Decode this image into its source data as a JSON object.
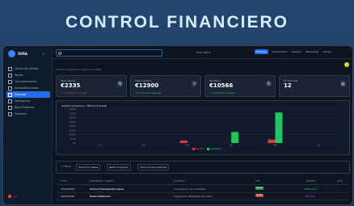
{
  "headline": "CONTROL FINANCIERO",
  "brand": {
    "name": "XERA",
    "close": "×"
  },
  "sidebar": {
    "items": [
      {
        "label": "Centro de Control",
        "active": false
      },
      {
        "label": "Tareas",
        "active": false
      },
      {
        "label": "Comunicaciones",
        "active": false
      },
      {
        "label": "Automatizaciones",
        "active": false
      },
      {
        "label": "Finanzas",
        "active": true
      },
      {
        "label": "Inteligencia",
        "active": false
      },
      {
        "label": "Base Sistemas",
        "active": false
      },
      {
        "label": "Miniones",
        "active": false
      }
    ],
    "footer": "Live"
  },
  "topbar": {
    "search_placeholder": "",
    "user": "Modo Maria",
    "nav": [
      {
        "label": "Finanzas",
        "active": true
      },
      {
        "label": "Contabilidad",
        "active": false
      },
      {
        "label": "Reporte",
        "active": false
      },
      {
        "label": "Marketing",
        "active": false
      },
      {
        "label": "Ventas",
        "active": false
      }
    ]
  },
  "subtitle": "Control de gastos e ingresos de XERA",
  "cards": [
    {
      "label": "Total Gastos",
      "value": "€2335",
      "sub": "↑ Incremento mensual",
      "sub_color": "#e05555",
      "icon": "%"
    },
    {
      "label": "Total Ingresos",
      "value": "€12900",
      "sub": "↑ Incremento mensual",
      "sub_color": "#28c76f",
      "icon": "↑"
    },
    {
      "label": "Beneficio",
      "value": "€10566",
      "sub": "↑ Incremento mensual",
      "sub_color": "#28c76f",
      "icon": "€"
    },
    {
      "label": "Nº Facturas",
      "value": "12",
      "sub": "",
      "sub_color": "#28c76f",
      "icon": "▤"
    }
  ],
  "chart_data": {
    "type": "bar",
    "title": "Gastos vs Ingresos - Últimos 6 meses",
    "categories": [
      "Ene",
      "Feb",
      "Mar",
      "Abr",
      "May",
      "Jun"
    ],
    "series": [
      {
        "name": "Gastos",
        "color": "#e03b3b",
        "values": [
          0,
          0,
          300,
          0,
          400,
          0
        ]
      },
      {
        "name": "Ingresos",
        "color": "#22c55e",
        "values": [
          0,
          0,
          0,
          1300,
          3600,
          0
        ]
      }
    ],
    "y_ticks": [
      "€4000",
      "€3500",
      "€3000",
      "€2500",
      "€2000",
      "€1500",
      "€1000",
      "€500",
      "€0"
    ],
    "ylim": [
      0,
      4000
    ],
    "legend_position": "bottom"
  },
  "filters": {
    "label": "Filtros",
    "selects": [
      "Todos los meses",
      "Gasto e Ingreso",
      "Todos los proveedores"
    ]
  },
  "table": {
    "headers": [
      "FECHA",
      "PROVEEDOR / CLIENTE",
      "CONCEPTO",
      "TIPO",
      "IMPORTE",
      "ACCS"
    ],
    "rows": [
      {
        "date": "30/05/2025",
        "party": "Clínica Fisioquinta López",
        "concept": "Consultoría e IA completa",
        "type": "Ingreso",
        "type_color": "#1f9d55",
        "amount": "+€500,00 €",
        "amount_color": "#2ecc71"
      },
      {
        "date": "30/05/2025",
        "party": "Meta Platforms",
        "concept": "Integración WhatsApp Business",
        "type": "Gasto",
        "type_color": "#d64545",
        "amount": "-€0,00 €",
        "amount_color": "#ef5350"
      }
    ]
  }
}
